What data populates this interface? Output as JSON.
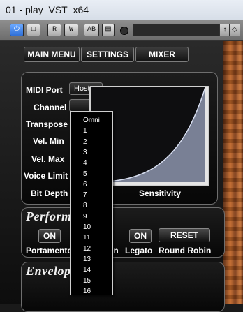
{
  "window": {
    "title": "01 - play_VST_x64"
  },
  "hostbar": {
    "power_label": "⏻",
    "btn_monitor_label": "□",
    "btn_read_label": "R",
    "btn_write_label": "W",
    "btn_compare_label": "AB",
    "btn_preset_label": "▤",
    "side_arrow": "↕",
    "side_gear": "◇",
    "preset_value": ""
  },
  "nav": {
    "main_menu": "MAIN MENU",
    "settings": "SETTINGS",
    "mixer": "MIXER"
  },
  "midi": {
    "midi_port_label": "MIDI Port",
    "midi_port_value": "Host",
    "channel_label": "Channel",
    "channel_value": "",
    "transpose_label": "Transpose",
    "vel_min_label": "Vel. Min",
    "vel_max_label": "Vel. Max",
    "voice_limit_label": "Voice Limit",
    "bit_depth_label": "Bit Depth",
    "sensitivity_label": "Sensitivity"
  },
  "performance": {
    "title": "Perform",
    "portamento_on": "ON",
    "portamento_label": "Portamento",
    "hidden_label": "on",
    "legato_on": "ON",
    "legato_label": "Legato",
    "reset_label": "RESET",
    "round_robin_label": "Round Robin"
  },
  "envelope": {
    "title": "Envelop"
  },
  "channel_dropdown": {
    "options": [
      "Omni",
      "1",
      "2",
      "3",
      "4",
      "5",
      "6",
      "7",
      "8",
      "9",
      "10",
      "11",
      "12",
      "13",
      "14",
      "15",
      "16"
    ]
  }
}
